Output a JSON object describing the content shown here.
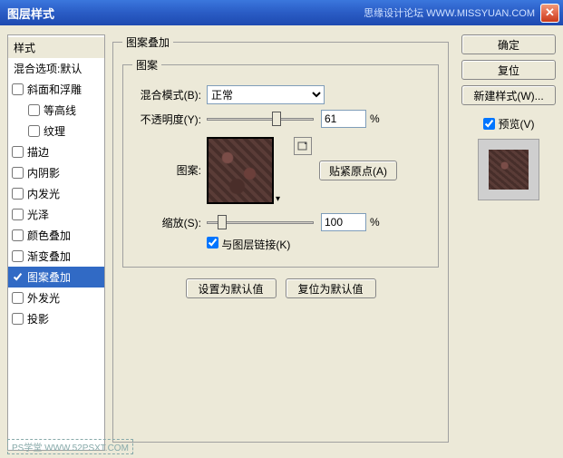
{
  "window": {
    "title": "图层样式",
    "brand": "思缘设计论坛  WWW.MISSYUAN.COM"
  },
  "sidebar": {
    "header": "样式",
    "blend_default": "混合选项:默认",
    "items": [
      {
        "label": "斜面和浮雕",
        "checked": false
      },
      {
        "label": "等高线",
        "checked": false,
        "indent": true
      },
      {
        "label": "纹理",
        "checked": false,
        "indent": true
      },
      {
        "label": "描边",
        "checked": false
      },
      {
        "label": "内阴影",
        "checked": false
      },
      {
        "label": "内发光",
        "checked": false
      },
      {
        "label": "光泽",
        "checked": false
      },
      {
        "label": "颜色叠加",
        "checked": false
      },
      {
        "label": "渐变叠加",
        "checked": false
      },
      {
        "label": "图案叠加",
        "checked": true,
        "selected": true
      },
      {
        "label": "外发光",
        "checked": false
      },
      {
        "label": "投影",
        "checked": false
      }
    ]
  },
  "panel": {
    "outer_legend": "图案叠加",
    "inner_legend": "图案",
    "blend_mode_label": "混合模式(B):",
    "blend_mode_value": "正常",
    "opacity_label": "不透明度(Y):",
    "opacity_value": "61",
    "opacity_pct": "%",
    "pattern_label": "图案:",
    "snap_button": "贴紧原点(A)",
    "scale_label": "缩放(S):",
    "scale_value": "100",
    "scale_pct": "%",
    "link_label": "与图层链接(K)",
    "set_default": "设置为默认值",
    "reset_default": "复位为默认值"
  },
  "right": {
    "ok": "确定",
    "reset": "复位",
    "new_style": "新建样式(W)...",
    "preview_label": "预览(V)"
  },
  "footer": "PS学堂  WWW.52PSXT.COM"
}
